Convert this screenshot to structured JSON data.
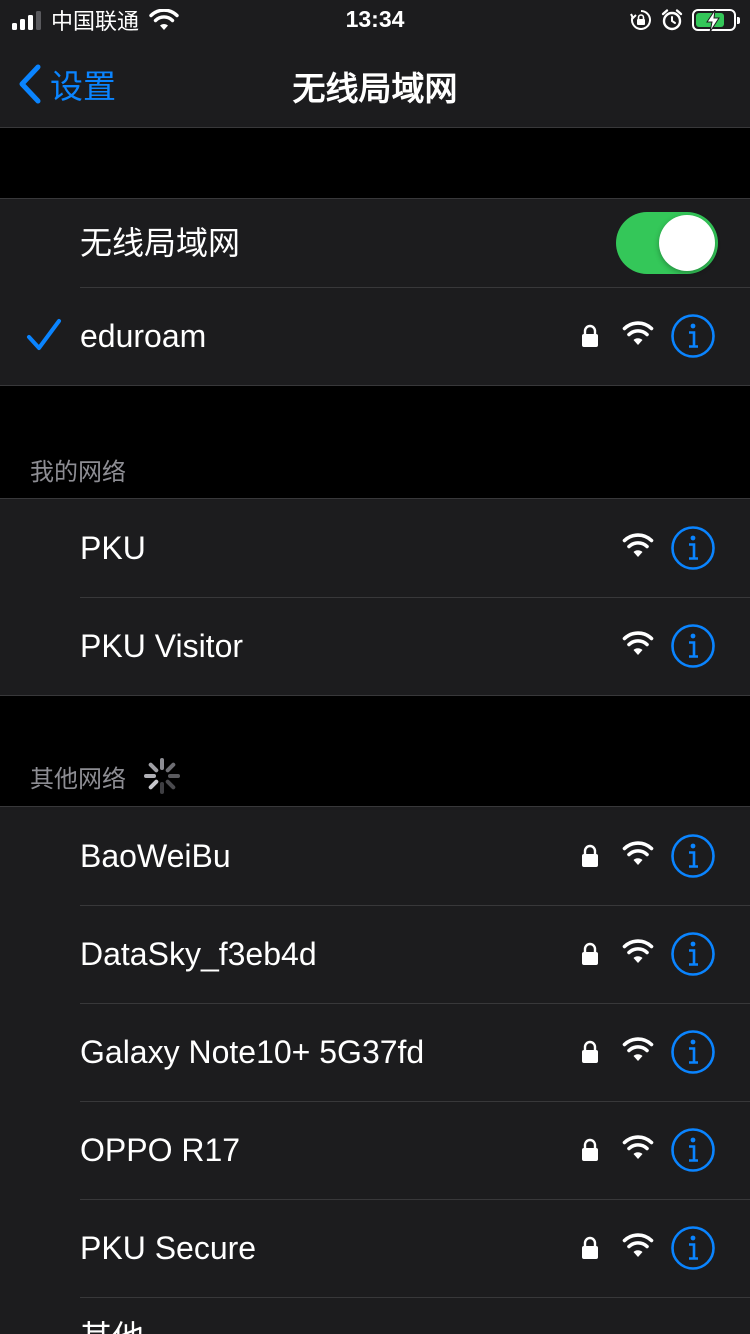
{
  "status_bar": {
    "carrier": "中国联通",
    "time": "13:34",
    "signal_bars_active": 3,
    "signal_bars_total": 4,
    "icons": [
      "wifi-icon",
      "orientation-lock-icon",
      "alarm-icon",
      "battery-charging-icon"
    ]
  },
  "nav": {
    "back_label": "设置",
    "title": "无线局域网"
  },
  "wifi_toggle": {
    "label": "无线局域网",
    "on": true
  },
  "connected": {
    "name": "eduroam",
    "secured": true
  },
  "my_networks": {
    "header": "我的网络",
    "items": [
      {
        "name": "PKU",
        "secured": false
      },
      {
        "name": "PKU Visitor",
        "secured": false
      }
    ]
  },
  "other_networks": {
    "header": "其他网络",
    "items": [
      {
        "name": "BaoWeiBu",
        "secured": true
      },
      {
        "name": "DataSky_f3eb4d",
        "secured": true
      },
      {
        "name": "Galaxy Note10+ 5G37fd",
        "secured": true
      },
      {
        "name": "OPPO R17",
        "secured": true
      },
      {
        "name": "PKU Secure",
        "secured": true
      },
      {
        "name": "其他...",
        "secured": false
      }
    ]
  },
  "colors": {
    "accent": "#0a84ff",
    "toggle_on": "#34c759",
    "background": "#000000",
    "cell": "#1c1c1e"
  }
}
